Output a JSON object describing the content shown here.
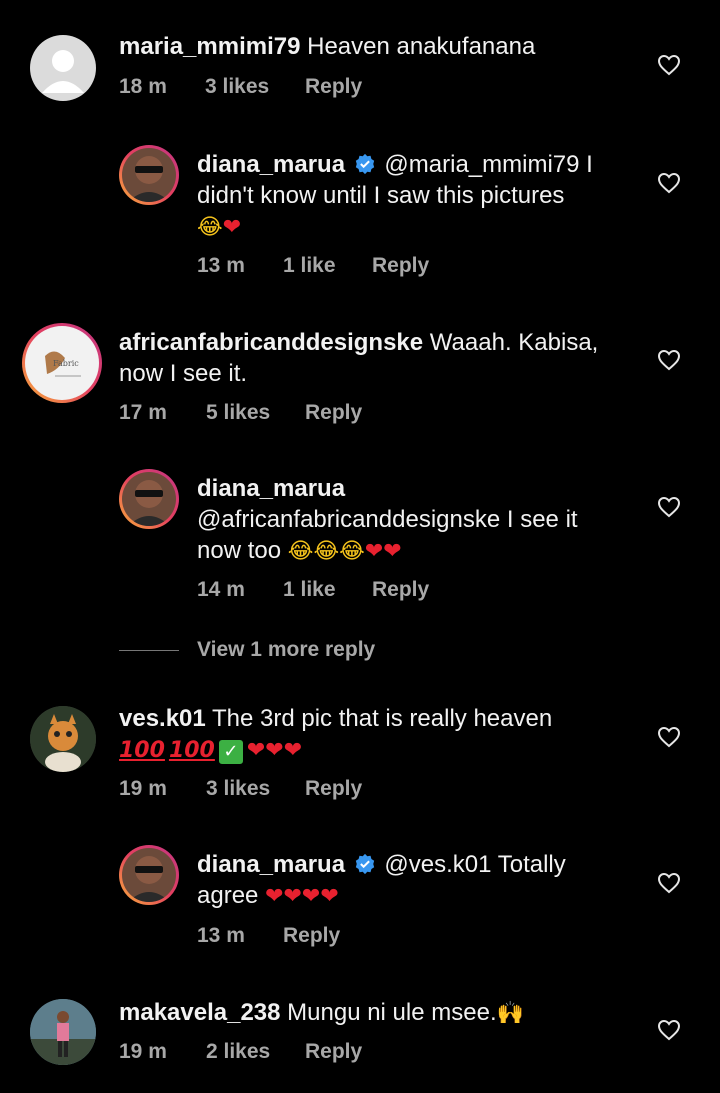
{
  "comments": [
    {
      "user": "maria_mmimi79",
      "text": "Heaven anakufanana",
      "time": "18 m",
      "likes": "3 likes",
      "reply": "Reply"
    },
    {
      "user": "diana_marua",
      "mention": "@maria_mmimi79",
      "text_line1_rest": " I",
      "text_line2": "didn't know until I saw this pictures",
      "time": "13 m",
      "likes": "1 like",
      "reply": "Reply"
    },
    {
      "user": "africanfabricanddesignske",
      "text": "Waaah. Kabisa,",
      "text_line2": "now I see it.",
      "time": "17 m",
      "likes": "5 likes",
      "reply": "Reply"
    },
    {
      "user": "diana_marua",
      "mention": "@africanfabricanddesignske",
      "text_line2_rest": "  I see it",
      "text_line3": "now too",
      "time": "14 m",
      "likes": "1 like",
      "reply": "Reply"
    },
    {
      "user": "ves.k01",
      "text": "The 3rd pic that is really heaven",
      "time": "19 m",
      "likes": "3 likes",
      "reply": "Reply"
    },
    {
      "user": "diana_marua",
      "mention": "@ves.k01",
      "text_rest": " Totally",
      "text_line2": "agree",
      "time": "13 m",
      "reply": "Reply"
    },
    {
      "user": "makavela_238",
      "text": "Mungu ni ule msee.",
      "time": "19 m",
      "likes": "2 likes",
      "reply": "Reply"
    }
  ],
  "view_more": "View 1 more reply",
  "colors": {
    "background": "#000000",
    "meta": "#a8a8a8",
    "verified": "#3897f0",
    "heart_red": "#e8212f"
  },
  "icons": [
    "heart-outline-icon",
    "verified-badge-icon",
    "laughing-emoji",
    "red-heart-emoji",
    "hundred-emoji",
    "check-emoji",
    "raised-hands-emoji"
  ]
}
